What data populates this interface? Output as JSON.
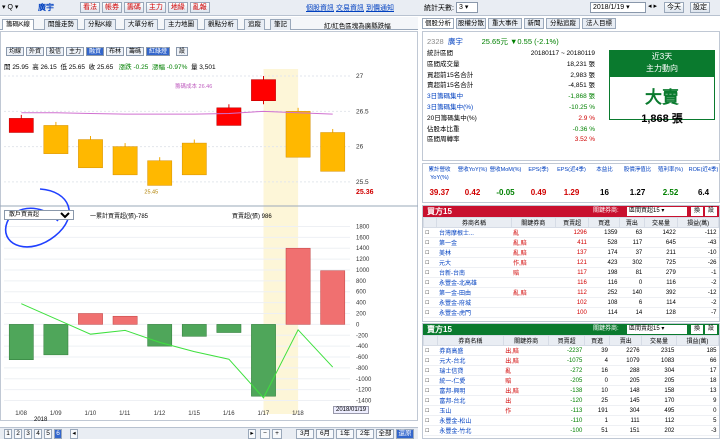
{
  "toolbar": {
    "stock": "廣宇",
    "buttons": [
      "看法",
      "帳券",
      "籌碼",
      "主力",
      "地緣",
      "亂報"
    ],
    "links": [
      "個股資訊",
      "交易資訊",
      "到價通知"
    ],
    "period_label": "統計天數:",
    "period_value": "3",
    "date": "2018/1/19",
    "today_label": "今天",
    "setting_label": "設定"
  },
  "left_tabs": [
    "籌碼K線",
    "開盤走勢",
    "分點K線",
    "大單分析",
    "主力地圖",
    "觀點分析",
    "追蹤",
    "筆記"
  ],
  "left_note": "紅/紅色區塊為廣縣跌幅",
  "chart_buttons": [
    "均線",
    "外資",
    "投信",
    "主力",
    "融資",
    "布林",
    "籌碼",
    "紅綠燈",
    "設"
  ],
  "ohlc": {
    "open_label": "開",
    "open": "25.95",
    "high_label": "高",
    "high": "26.15",
    "low_label": "低",
    "low": "25.65",
    "close_label": "收",
    "close": "25.65",
    "chg_label": "漲跌",
    "chg": "-0.25",
    "pct_label": "漲幅",
    "pct": "-0.97%",
    "vol_label": "量",
    "vol": "3,501"
  },
  "ma_label": "籌碼成本 26.46",
  "price_axis": [
    "27",
    "26.5",
    "26",
    "25.5"
  ],
  "current_price": "25.36",
  "low_marker": "25.45",
  "sub_select": "散戶買賣超",
  "legend": {
    "line": "一累計買賣超(張)-785",
    "bar": "買賣超(張) 986"
  },
  "vol_axis": [
    "1800",
    "1600",
    "1400",
    "1200",
    "1000",
    "800",
    "600",
    "400",
    "200",
    "0",
    "-200",
    "-400",
    "-600",
    "-800",
    "-1000",
    "-1200",
    "-1400"
  ],
  "dates": [
    "1/08",
    "1/09",
    "1/10",
    "1/11",
    "1/12",
    "1/15",
    "1/16",
    "1/17",
    "1/18"
  ],
  "year_label": "2018",
  "cur_date": "2018/01/19",
  "chart_data": {
    "type": "bar",
    "title": "",
    "categories": [
      "1/08",
      "1/09",
      "1/10",
      "1/11",
      "1/12",
      "1/15",
      "1/16",
      "1/17",
      "1/18",
      "1/19"
    ],
    "candles": [
      {
        "o": 26.2,
        "c": 26.4,
        "h": 26.45,
        "l": 26.2,
        "up": true
      },
      {
        "o": 26.3,
        "c": 25.9,
        "h": 26.35,
        "l": 25.9,
        "up": false
      },
      {
        "o": 26.1,
        "c": 25.7,
        "h": 26.15,
        "l": 25.7,
        "up": false
      },
      {
        "o": 26.0,
        "c": 25.6,
        "h": 26.05,
        "l": 25.6,
        "up": false
      },
      {
        "o": 25.8,
        "c": 25.45,
        "h": 25.85,
        "l": 25.45,
        "up": false
      },
      {
        "o": 26.05,
        "c": 25.6,
        "h": 26.1,
        "l": 25.6,
        "up": false
      },
      {
        "o": 26.3,
        "c": 26.55,
        "h": 26.6,
        "l": 26.3,
        "up": true
      },
      {
        "o": 26.65,
        "c": 26.95,
        "h": 27.0,
        "l": 26.6,
        "up": true
      },
      {
        "o": 26.5,
        "c": 25.85,
        "h": 26.55,
        "l": 25.85,
        "up": false
      },
      {
        "o": 26.2,
        "c": 25.65,
        "h": 26.25,
        "l": 25.65,
        "up": false
      }
    ],
    "ma": [
      26.48,
      26.48,
      26.47,
      26.46,
      26.46,
      26.46,
      26.47,
      26.5,
      26.48,
      26.46
    ],
    "net": [
      -650,
      -560,
      200,
      150,
      -400,
      -220,
      -150,
      -1320,
      1400,
      986
    ],
    "cum": [
      380,
      100,
      -180,
      -110,
      -330,
      -500,
      -640,
      -1350,
      -100,
      -785
    ],
    "price_ylim": [
      25.3,
      27.1
    ],
    "vol_ylim": [
      -1500,
      1900
    ]
  },
  "right_tabs": [
    "個股分析",
    "股權分散",
    "重大事件",
    "新聞",
    "分點追蹤",
    "法人目標"
  ],
  "stock_line": {
    "code": "2328",
    "name": "廣宇",
    "price": "25.65元",
    "chg": "▼0.55 (-2.1%)"
  },
  "stats": [
    {
      "k": "統計區間",
      "v": "20180117 ~ 20180119"
    },
    {
      "k": "區間成交量",
      "v": "18,231 張"
    },
    {
      "k": "買超前15名合計",
      "v": "2,983 張"
    },
    {
      "k": "賣超前15名合計",
      "v": "-4,851 張"
    },
    {
      "k": "3日籌碼集中",
      "v": "-1,868 張"
    },
    {
      "k": "3日籌碼集中(%)",
      "v": "-10.25 %"
    },
    {
      "k": "20日籌碼集中(%)",
      "v": "2.9 %"
    },
    {
      "k": "佔股本比重",
      "v": "-0.36 %"
    },
    {
      "k": "區間周轉率",
      "v": "3.52 %"
    }
  ],
  "trend": {
    "title1": "近3天",
    "title2": "主力動向",
    "label": "大賣",
    "value": "1,868 張"
  },
  "fund_headers": [
    "累計營收YoY(%)",
    "營收YoY(%)",
    "營收MoM(%)",
    "EPS(季)",
    "EPS(近4季)",
    "本益比",
    "股價淨值比",
    "殖利率(%)",
    "ROE(近4季)"
  ],
  "fund_values": [
    "39.37",
    "0.42",
    "-0.05",
    "0.49",
    "1.29",
    "16",
    "1.27",
    "2.52",
    "6.4"
  ],
  "buy15": {
    "title": "買方15",
    "filter_label": "關鍵券商:",
    "filter": "區間買超15",
    "btn1": "換",
    "btn2": "設",
    "headers": [
      "",
      "券商名稱",
      "關鍵券商",
      "買賣超",
      "買進",
      "賣出",
      "交易量",
      "損益(萬)"
    ],
    "rows": [
      [
        "台灣摩根士...",
        "亂",
        "1296",
        "1359",
        "63",
        "1422",
        "-112"
      ],
      [
        "第一金",
        "亂,賠",
        "411",
        "528",
        "117",
        "645",
        "-43"
      ],
      [
        "美林",
        "亂,賠",
        "137",
        "174",
        "37",
        "211",
        "-10"
      ],
      [
        "元大",
        "作,賠",
        "121",
        "423",
        "302",
        "725",
        "-26"
      ],
      [
        "台新-台南",
        "賠",
        "117",
        "198",
        "81",
        "279",
        "-1"
      ],
      [
        "永豐金-北高雄",
        "",
        "116",
        "116",
        "0",
        "116",
        "-2"
      ],
      [
        "第一金-田由",
        "亂,賠",
        "112",
        "252",
        "140",
        "392",
        "-12"
      ],
      [
        "永豐金-府城",
        "",
        "102",
        "108",
        "6",
        "114",
        "-2"
      ],
      [
        "永豐金-虎門",
        "",
        "100",
        "114",
        "14",
        "128",
        "-7"
      ]
    ]
  },
  "sell15": {
    "title": "賣方15",
    "filter_label": "關鍵券商:",
    "filter": "區間賣超15",
    "btn1": "換",
    "btn2": "設",
    "headers": [
      "",
      "券商名稱",
      "關鍵券商",
      "買賣超",
      "買進",
      "賣出",
      "交易量",
      "損益(萬)"
    ],
    "rows": [
      [
        "券商高盛",
        "出,賠",
        "-2237",
        "39",
        "2276",
        "2315",
        "185"
      ],
      [
        "元大-台北",
        "出,賠",
        "-1075",
        "4",
        "1079",
        "1083",
        "66"
      ],
      [
        "瑞士信貸",
        "亂",
        "-272",
        "16",
        "288",
        "304",
        "17"
      ],
      [
        "統一-仁愛",
        "賠",
        "-205",
        "0",
        "205",
        "205",
        "18"
      ],
      [
        "富邦-興明",
        "出,賠",
        "-138",
        "10",
        "148",
        "158",
        "13"
      ],
      [
        "富邦-台北",
        "出",
        "-120",
        "25",
        "145",
        "170",
        "9"
      ],
      [
        "玉山",
        "作",
        "-113",
        "191",
        "304",
        "495",
        "0"
      ],
      [
        "永豐金-松山",
        "",
        "-110",
        "1",
        "111",
        "112",
        "5"
      ],
      [
        "永豐金-竹北",
        "",
        "-100",
        "51",
        "151",
        "202",
        "-3"
      ]
    ]
  },
  "bottom": {
    "nums": [
      "1",
      "2",
      "3",
      "4",
      "5",
      "6"
    ],
    "active": "6",
    "zoom": [
      "3月",
      "6月",
      "1年",
      "2年",
      "全部",
      "還原"
    ]
  }
}
